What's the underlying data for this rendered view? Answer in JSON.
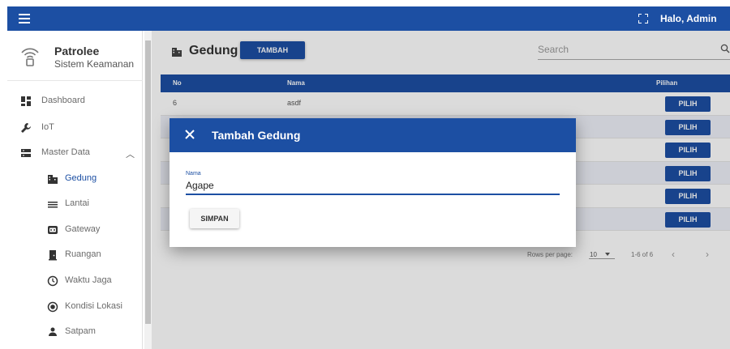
{
  "appbar": {
    "greeting": "Halo, Admin",
    "menu_icon": "hamburger-menu-icon",
    "fullscreen_icon": "fullscreen-icon",
    "color": "#1c4fa3"
  },
  "brand": {
    "name": "Patrolee",
    "subtitle": "Sistem Keamanan",
    "logo_icon": "wifi-signal-logo-icon"
  },
  "sidebar": {
    "items": [
      {
        "label": "Dashboard",
        "icon": "dashboard-icon",
        "level": "top"
      },
      {
        "label": "IoT",
        "icon": "wrench-icon",
        "level": "top"
      },
      {
        "label": "Master Data",
        "icon": "storage-icon",
        "level": "top",
        "expanded": true
      },
      {
        "label": "Gedung",
        "icon": "building-icon",
        "level": "sub",
        "active": true
      },
      {
        "label": "Lantai",
        "icon": "list-icon",
        "level": "sub"
      },
      {
        "label": "Gateway",
        "icon": "router-icon",
        "level": "sub"
      },
      {
        "label": "Ruangan",
        "icon": "door-icon",
        "level": "sub"
      },
      {
        "label": "Waktu Jaga",
        "icon": "clock-icon",
        "level": "sub"
      },
      {
        "label": "Kondisi Lokasi",
        "icon": "radio-button-icon",
        "level": "sub"
      },
      {
        "label": "Satpam",
        "icon": "person-icon",
        "level": "sub"
      }
    ]
  },
  "main": {
    "title": "Gedung",
    "add_button": "TAMBAH",
    "search_placeholder": "Search",
    "table": {
      "columns": [
        "No",
        "Nama",
        "Pilihan"
      ],
      "rows": [
        {
          "no": "6",
          "nama": "asdf",
          "action": "PILIH"
        },
        {
          "no": "",
          "nama": "",
          "action": "PILIH"
        },
        {
          "no": "",
          "nama": "",
          "action": "PILIH"
        },
        {
          "no": "",
          "nama": "",
          "action": "PILIH"
        },
        {
          "no": "",
          "nama": "",
          "action": "PILIH"
        },
        {
          "no": "",
          "nama": "",
          "action": "PILIH"
        }
      ]
    },
    "pagination": {
      "rows_per_page_label": "Rows per page:",
      "rows_per_page_value": "10",
      "range": "1-6 of 6",
      "prev": "‹",
      "next": "›"
    }
  },
  "dialog": {
    "title": "Tambah Gedung",
    "close_icon": "close-icon",
    "field_label": "Nama",
    "field_value": "Agape",
    "submit_label": "SIMPAN"
  }
}
